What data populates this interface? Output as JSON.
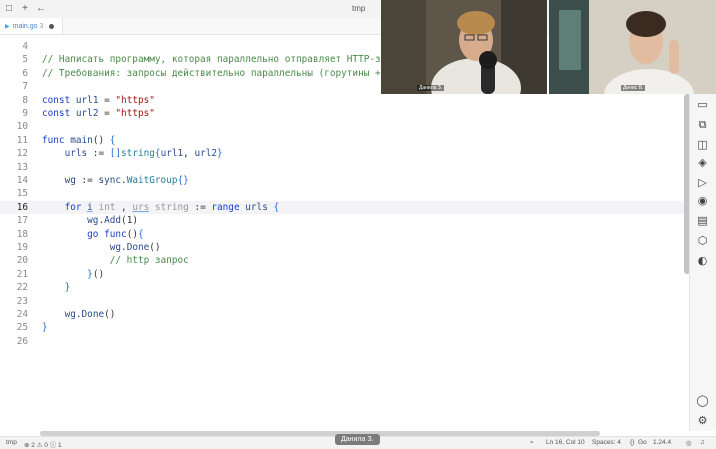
{
  "window": {
    "title": "tmp"
  },
  "titlebar_icons": [
    "square-icon",
    "plus-icon",
    "arrow-left-icon"
  ],
  "tab": {
    "label": "main.go",
    "count": "3"
  },
  "editor": {
    "lines": [
      {
        "n": "4",
        "tokens": []
      },
      {
        "n": "5",
        "tokens": [
          {
            "c": "cm",
            "t": "// Написать программу, которая параллельно отправляет HTTP-за"
          }
        ]
      },
      {
        "n": "6",
        "tokens": [
          {
            "c": "cm",
            "t": "// Требования: запросы действительно параллельны (горутины + W"
          }
        ]
      },
      {
        "n": "7",
        "tokens": []
      },
      {
        "n": "8",
        "tokens": [
          {
            "c": "kw",
            "t": "const"
          },
          {
            "c": "op",
            "t": " "
          },
          {
            "c": "id",
            "t": "url1"
          },
          {
            "c": "op",
            "t": " = "
          },
          {
            "c": "str",
            "t": "\"https\""
          }
        ]
      },
      {
        "n": "9",
        "tokens": [
          {
            "c": "kw",
            "t": "const"
          },
          {
            "c": "op",
            "t": " "
          },
          {
            "c": "id",
            "t": "url2"
          },
          {
            "c": "op",
            "t": " = "
          },
          {
            "c": "str",
            "t": "\"https\""
          }
        ]
      },
      {
        "n": "10",
        "tokens": []
      },
      {
        "n": "11",
        "tokens": [
          {
            "c": "kw",
            "t": "func"
          },
          {
            "c": "op",
            "t": " "
          },
          {
            "c": "fn",
            "t": "main"
          },
          {
            "c": "op",
            "t": "() "
          },
          {
            "c": "br",
            "t": "{"
          }
        ]
      },
      {
        "n": "12",
        "tokens": [
          {
            "c": "op",
            "t": "    "
          },
          {
            "c": "id",
            "t": "urls"
          },
          {
            "c": "op",
            "t": " := "
          },
          {
            "c": "br",
            "t": "[]"
          },
          {
            "c": "typ",
            "t": "string"
          },
          {
            "c": "br",
            "t": "{"
          },
          {
            "c": "id",
            "t": "url1"
          },
          {
            "c": "op",
            "t": ", "
          },
          {
            "c": "id",
            "t": "url2"
          },
          {
            "c": "br",
            "t": "}"
          }
        ]
      },
      {
        "n": "13",
        "tokens": []
      },
      {
        "n": "14",
        "tokens": [
          {
            "c": "op",
            "t": "    "
          },
          {
            "c": "id",
            "t": "wg"
          },
          {
            "c": "op",
            "t": " := "
          },
          {
            "c": "id",
            "t": "sync"
          },
          {
            "c": "op",
            "t": "."
          },
          {
            "c": "typ",
            "t": "WaitGroup"
          },
          {
            "c": "br",
            "t": "{}"
          }
        ]
      },
      {
        "n": "15",
        "tokens": []
      },
      {
        "n": "16",
        "current": true,
        "tokens": [
          {
            "c": "op",
            "t": "    "
          },
          {
            "c": "kw",
            "t": "for"
          },
          {
            "c": "op",
            "t": " "
          },
          {
            "c": "und id",
            "t": "i"
          },
          {
            "c": "hint",
            "t": " int"
          },
          {
            "c": "op",
            "t": " , "
          },
          {
            "c": "und hint",
            "t": "urs"
          },
          {
            "c": "hint",
            "t": " string"
          },
          {
            "c": "op",
            "t": " := "
          },
          {
            "c": "kw",
            "t": "range"
          },
          {
            "c": "op",
            "t": " "
          },
          {
            "c": "id",
            "t": "urls"
          },
          {
            "c": "op",
            "t": " "
          },
          {
            "c": "br",
            "t": "{"
          }
        ]
      },
      {
        "n": "17",
        "tokens": [
          {
            "c": "op",
            "t": "        "
          },
          {
            "c": "id",
            "t": "wg"
          },
          {
            "c": "op",
            "t": "."
          },
          {
            "c": "fn",
            "t": "Add"
          },
          {
            "c": "op",
            "t": "(1)"
          }
        ]
      },
      {
        "n": "18",
        "tokens": [
          {
            "c": "op",
            "t": "        "
          },
          {
            "c": "kw",
            "t": "go"
          },
          {
            "c": "op",
            "t": " "
          },
          {
            "c": "kw",
            "t": "func"
          },
          {
            "c": "op",
            "t": "()"
          },
          {
            "c": "br",
            "t": "{"
          }
        ]
      },
      {
        "n": "19",
        "tokens": [
          {
            "c": "op",
            "t": "            "
          },
          {
            "c": "id",
            "t": "wg"
          },
          {
            "c": "op",
            "t": "."
          },
          {
            "c": "fn",
            "t": "Done"
          },
          {
            "c": "op",
            "t": "()"
          }
        ]
      },
      {
        "n": "20",
        "tokens": [
          {
            "c": "op",
            "t": "            "
          },
          {
            "c": "cm",
            "t": "// http запрос"
          }
        ]
      },
      {
        "n": "21",
        "tokens": [
          {
            "c": "op",
            "t": "        "
          },
          {
            "c": "br",
            "t": "}"
          },
          {
            "c": "op",
            "t": "()"
          }
        ]
      },
      {
        "n": "22",
        "tokens": [
          {
            "c": "op",
            "t": "    "
          },
          {
            "c": "br",
            "t": "}"
          }
        ]
      },
      {
        "n": "23",
        "tokens": []
      },
      {
        "n": "24",
        "tokens": [
          {
            "c": "op",
            "t": "    "
          },
          {
            "c": "id",
            "t": "wg"
          },
          {
            "c": "op",
            "t": "."
          },
          {
            "c": "fn",
            "t": "Done"
          },
          {
            "c": "op",
            "t": "()"
          }
        ]
      },
      {
        "n": "25",
        "tokens": [
          {
            "c": "br",
            "t": "}"
          }
        ]
      },
      {
        "n": "26",
        "tokens": []
      }
    ]
  },
  "right_icons": [
    "layout-icon",
    "remote-icon",
    "extensions-icon",
    "gitlens-icon",
    "run-icon",
    "record-icon",
    "database-icon",
    "package-icon",
    "chrome-icon"
  ],
  "right_bottom_icons": [
    "account-icon",
    "settings-icon"
  ],
  "status": {
    "branch": "tmp",
    "problems": "⊗ 2 ⚠ 0 ⓘ 1",
    "position": "Ln 16, Col 10",
    "spaces": "Spaces: 4",
    "lang": "Go",
    "version": "1.24.4",
    "speaker": "Данила З."
  },
  "video": {
    "p1_name": "Данила З.",
    "p2_name": "Денис В."
  },
  "colors": {
    "keyword": "#1a3ec9",
    "string": "#a31515",
    "comment": "#4a8a4a",
    "type": "#267f99"
  }
}
